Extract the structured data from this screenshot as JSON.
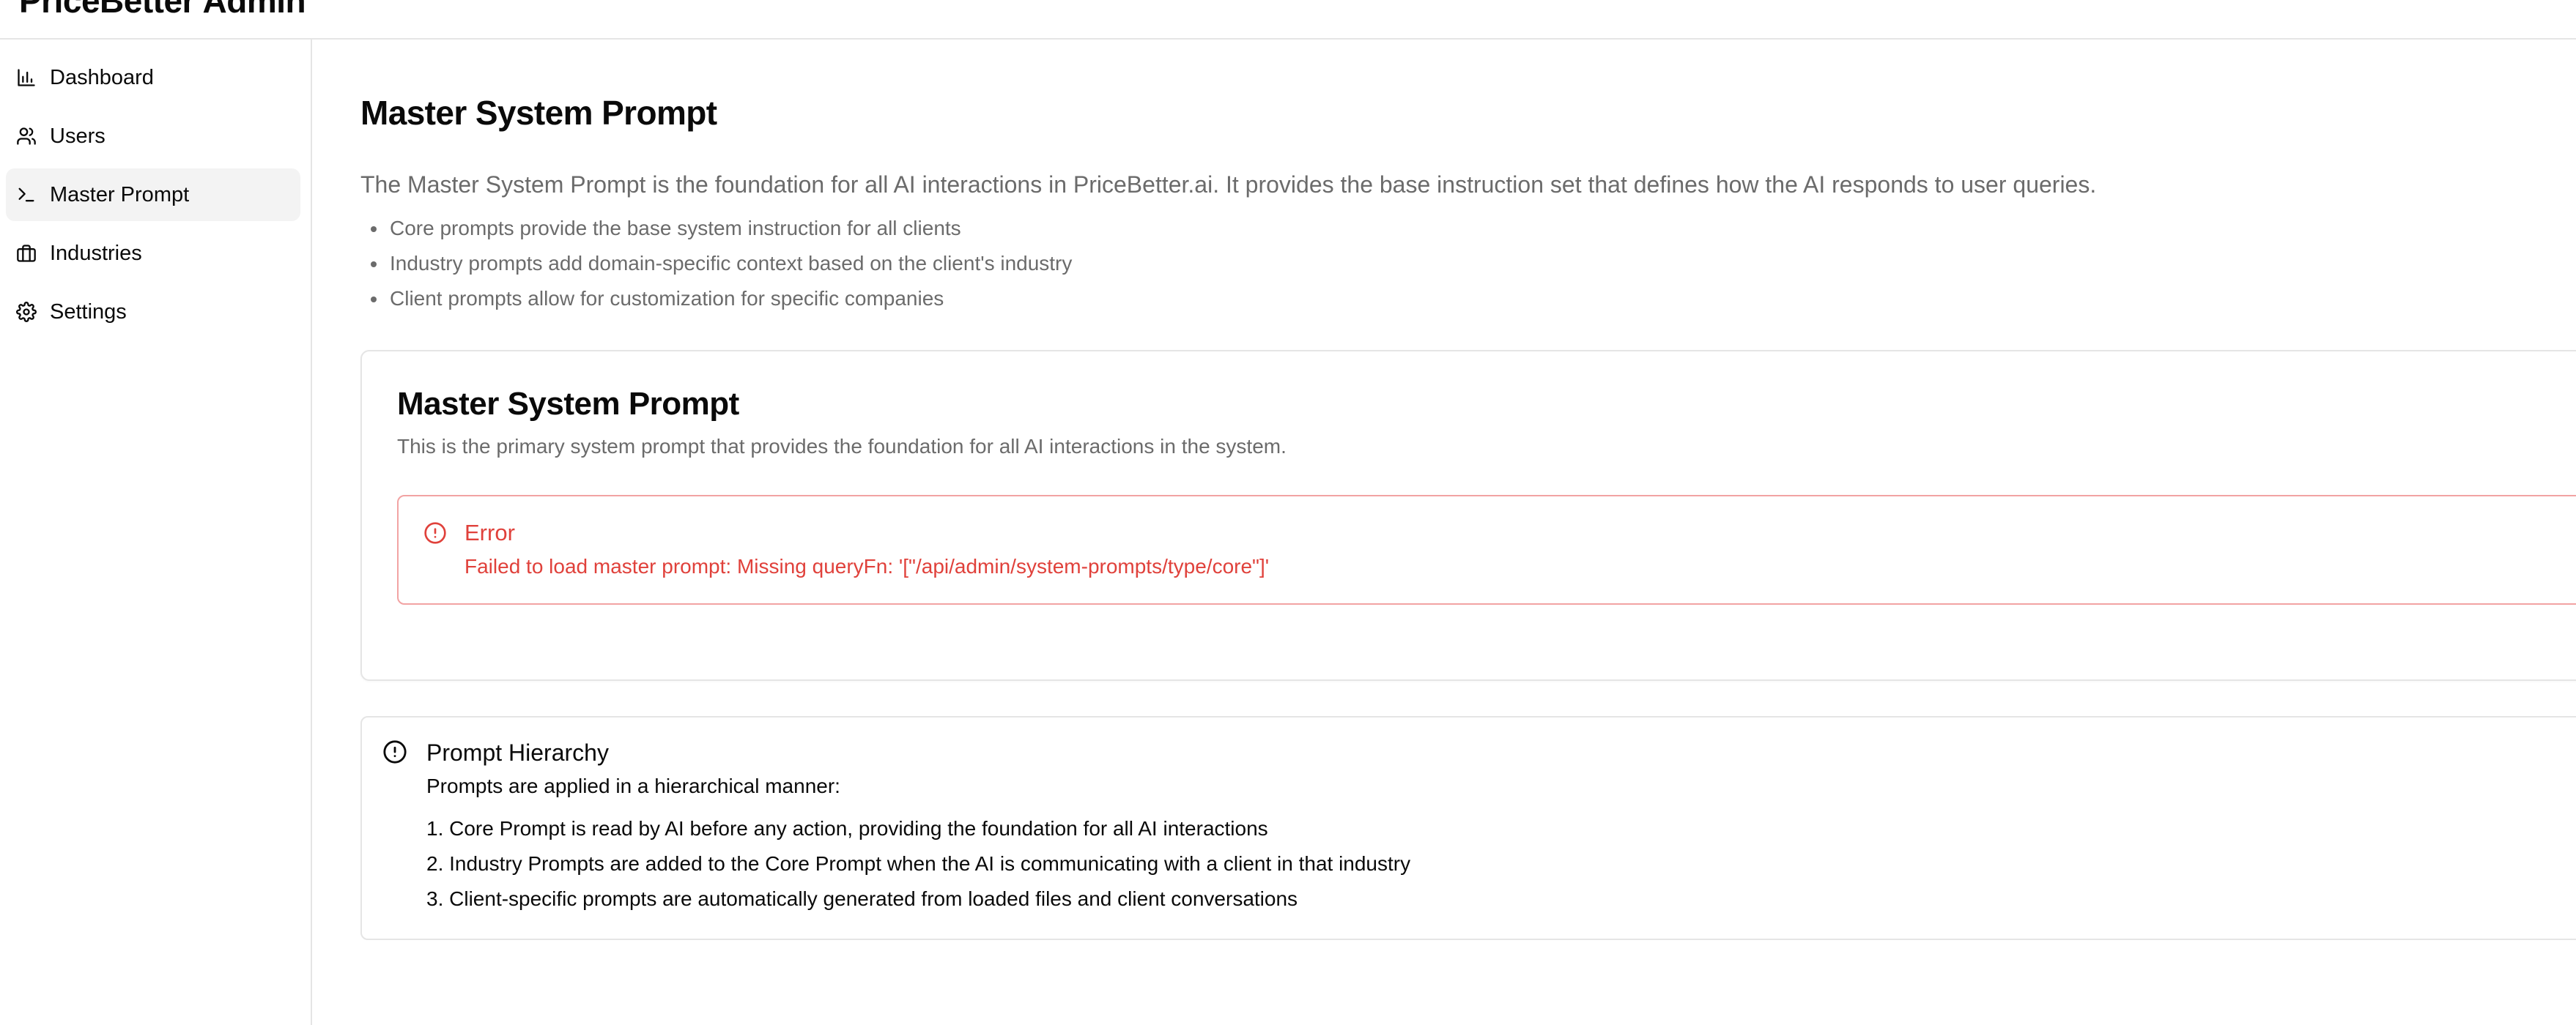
{
  "app": {
    "title": "PriceBetter Admin"
  },
  "sidebar": {
    "items": [
      {
        "label": "Dashboard",
        "icon": "bar-chart-icon",
        "active": false
      },
      {
        "label": "Users",
        "icon": "users-icon",
        "active": false
      },
      {
        "label": "Master Prompt",
        "icon": "terminal-icon",
        "active": true
      },
      {
        "label": "Industries",
        "icon": "briefcase-icon",
        "active": false
      },
      {
        "label": "Settings",
        "icon": "gear-icon",
        "active": false
      }
    ]
  },
  "main": {
    "title": "Master System Prompt",
    "description": "The Master System Prompt is the foundation for all AI interactions in PriceBetter.ai. It provides the base instruction set that defines how the AI responds to user queries.",
    "bullets": [
      "Core prompts provide the base system instruction for all clients",
      "Industry prompts add domain-specific context based on the client's industry",
      "Client prompts allow for customization for specific companies"
    ],
    "card": {
      "title": "Master System Prompt",
      "description": "This is the primary system prompt that provides the foundation for all AI interactions in the system.",
      "error": {
        "icon": "alert-circle-icon",
        "title": "Error",
        "message": "Failed to load master prompt: Missing queryFn: '[\"/api/admin/system-prompts/type/core\"]'"
      }
    },
    "hierarchy": {
      "icon": "info-circle-icon",
      "title": "Prompt Hierarchy",
      "intro": "Prompts are applied in a hierarchical manner:",
      "items": [
        "1. Core Prompt is read by AI before any action, providing the foundation for all AI interactions",
        "2. Industry Prompts are added to the Core Prompt when the AI is communicating with a client in that industry",
        "3. Client-specific prompts are automatically generated from loaded files and client conversations"
      ]
    }
  },
  "colors": {
    "error": "#e0413b",
    "error_border": "#f2a3a3",
    "muted_text": "#6b6b6b",
    "border": "#e5e5e5",
    "active_nav_bg": "#f3f3f3"
  }
}
